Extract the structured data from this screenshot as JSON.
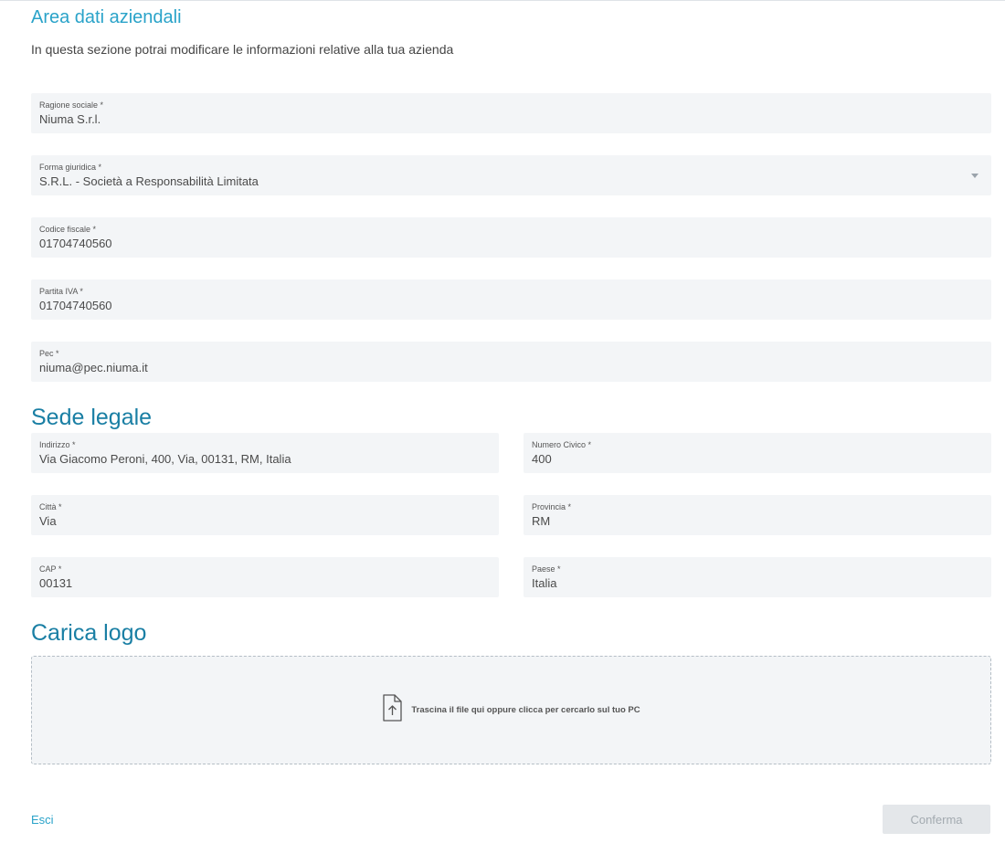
{
  "header": {
    "title": "Area dati aziendali",
    "subtitle": "In questa sezione potrai modificare le informazioni relative alla tua azienda"
  },
  "company": {
    "ragione_sociale": {
      "label": "Ragione sociale *",
      "value": "Niuma S.r.l."
    },
    "forma_giuridica": {
      "label": "Forma giuridica *",
      "value": "S.R.L. - Società a Responsabilità Limitata"
    },
    "codice_fiscale": {
      "label": "Codice fiscale *",
      "value": "01704740560"
    },
    "partita_iva": {
      "label": "Partita IVA *",
      "value": "01704740560"
    },
    "pec": {
      "label": "Pec *",
      "value": "niuma@pec.niuma.it"
    }
  },
  "sede_legale": {
    "title": "Sede legale",
    "indirizzo": {
      "label": "Indirizzo *",
      "value": "Via Giacomo Peroni, 400, Via, 00131, RM, Italia"
    },
    "numero_civico": {
      "label": "Numero Civico *",
      "value": "400"
    },
    "citta": {
      "label": "Città *",
      "value": "Via"
    },
    "provincia": {
      "label": "Provincia *",
      "value": "RM"
    },
    "cap": {
      "label": "CAP *",
      "value": "00131"
    },
    "paese": {
      "label": "Paese *",
      "value": "Italia"
    }
  },
  "logo": {
    "title": "Carica logo",
    "dropzone_text": "Trascina il file qui oppure clicca per cercarlo sul tuo PC",
    "icon": "file-upload-icon"
  },
  "footer": {
    "exit_label": "Esci",
    "confirm_label": "Conferma"
  },
  "colors": {
    "title": "#2aa3c9",
    "section_title": "#1a7fa4",
    "field_bg": "#f3f5f7",
    "disabled_button_bg": "#e4e7ea"
  }
}
